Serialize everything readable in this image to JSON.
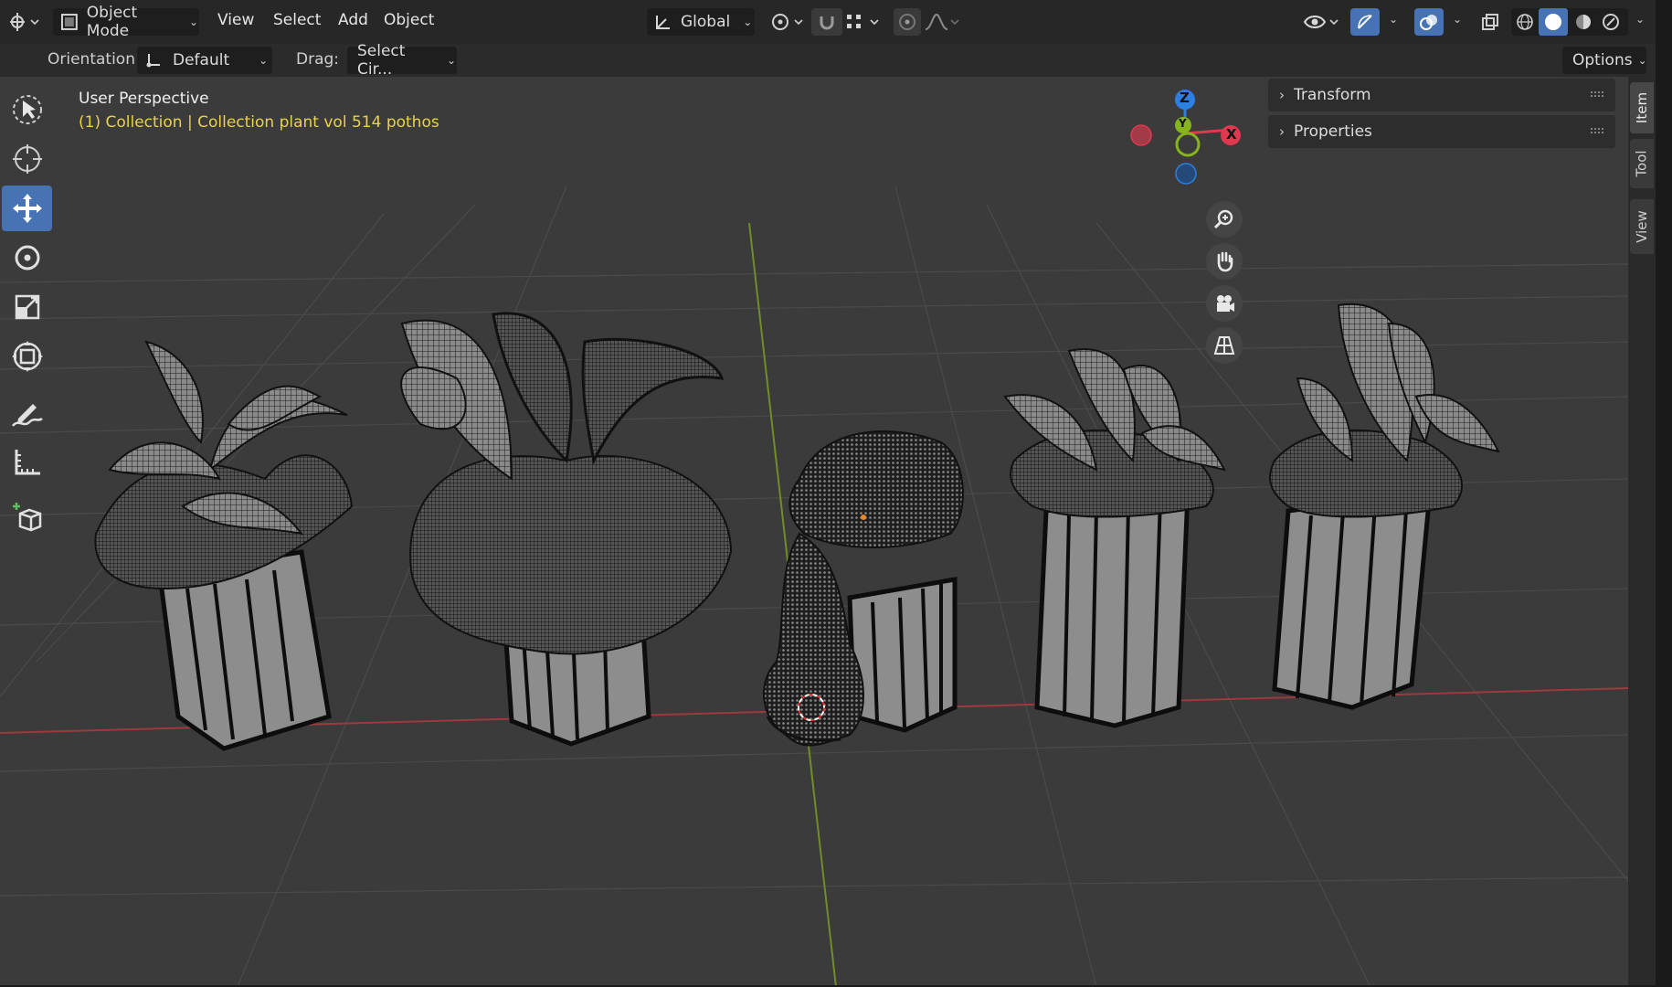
{
  "header": {
    "mode_label": "Object Mode",
    "menus": [
      "View",
      "Select",
      "Add",
      "Object"
    ],
    "transform_orientation": "Global",
    "options_label": "Options"
  },
  "tool_settings": {
    "orientation_label": "Orientation:",
    "orientation_value": "Default",
    "drag_label": "Drag:",
    "drag_value": "Select Cir..."
  },
  "viewport": {
    "view_name": "User Perspective",
    "collection_info": "(1) Collection | Collection plant vol 514 pothos",
    "info_color": "#e8d24a"
  },
  "gizmo": {
    "z": "Z",
    "y": "Y",
    "x": "X",
    "colors": {
      "x": "#e0394f",
      "y": "#86b41e",
      "z": "#2d7fe0"
    }
  },
  "sidebar": {
    "panels": [
      "Transform",
      "Properties"
    ],
    "tabs": [
      "Item",
      "Tool",
      "View"
    ],
    "active_tab": "Item"
  },
  "toolbar": {
    "tools": [
      "select-box",
      "cursor",
      "move",
      "rotate",
      "scale",
      "transform",
      "annotate",
      "measure",
      "add-cube"
    ],
    "active_tool": "move",
    "active_color": "#4772b3"
  },
  "shading": {
    "active_mode": "solid"
  }
}
